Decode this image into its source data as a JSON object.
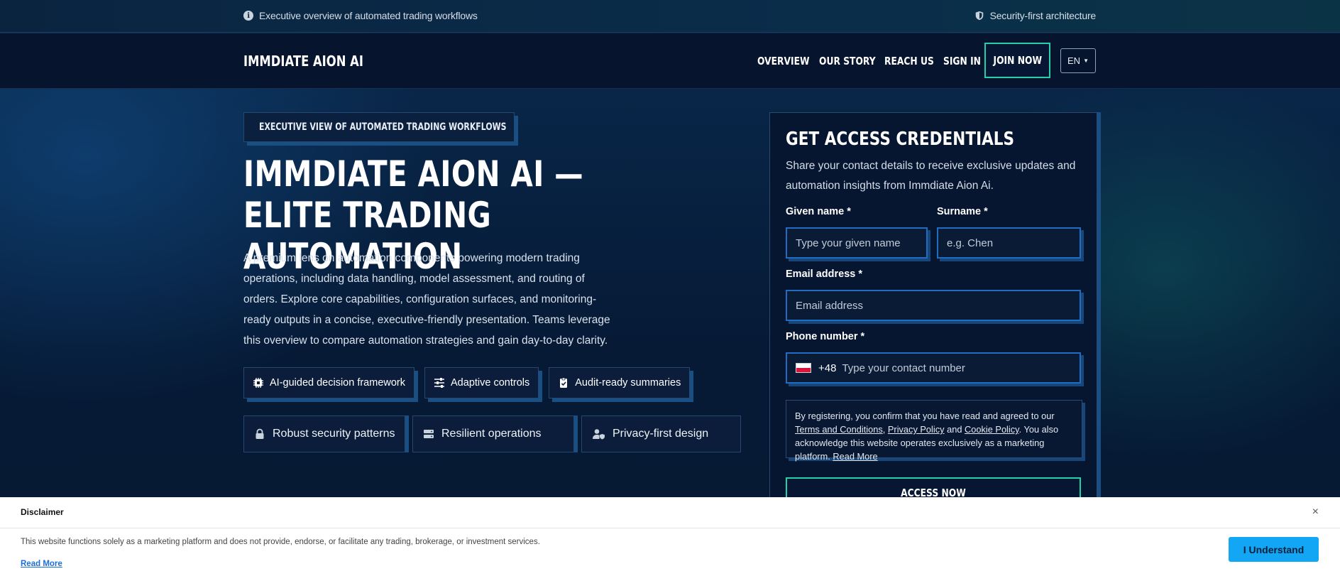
{
  "topbar": {
    "info_text": "Executive overview of automated trading workflows",
    "security_text": "Security-first architecture"
  },
  "nav": {
    "brand": "IMMDIATE AION AI",
    "links": [
      "OVERVIEW",
      "OUR STORY",
      "REACH US",
      "SIGN IN"
    ],
    "join_label": "JOIN NOW",
    "language": "EN"
  },
  "hero": {
    "eyebrow": "EXECUTIVE VIEW OF AUTOMATED TRADING WORKFLOWS",
    "title": "IMMDIATE AION AI — ELITE TRADING AUTOMATION",
    "description": "A premium lens on automation components powering modern trading operations, including data handling, model assessment, and routing of orders. Explore core capabilities, configuration surfaces, and monitoring-ready outputs in a concise, executive-friendly presentation. Teams leverage this overview to compare automation strategies and gain day-to-day clarity.",
    "chips": [
      {
        "label": "AI-guided decision framework",
        "icon": "chip-icon"
      },
      {
        "label": "Adaptive controls",
        "icon": "sliders-icon"
      },
      {
        "label": "Audit-ready summaries",
        "icon": "clipboard-check-icon"
      }
    ],
    "features": [
      {
        "label": "Robust security patterns",
        "icon": "lock-icon"
      },
      {
        "label": "Resilient operations",
        "icon": "server-icon"
      },
      {
        "label": "Privacy-first design",
        "icon": "user-shield-icon"
      }
    ]
  },
  "form": {
    "title": "GET ACCESS CREDENTIALS",
    "subtitle": "Share your contact details to receive exclusive updates and automation insights from Immdiate Aion Ai.",
    "given_name_label": "Given name *",
    "given_name_placeholder": "Type your given name",
    "surname_label": "Surname *",
    "surname_placeholder": "e.g. Chen",
    "email_label": "Email address *",
    "email_placeholder": "Email address",
    "phone_label": "Phone number *",
    "phone_prefix": "+48",
    "phone_placeholder": "Type your contact number",
    "consent_prefix": "By registering, you confirm that you have read and agreed to our ",
    "terms_link": "Terms and Conditions",
    "sep1": ", ",
    "privacy_link": "Privacy Policy",
    "sep2": " and ",
    "cookie_link": "Cookie Policy",
    "consent_suffix": ". You also acknowledge this website operates exclusively as a marketing platform. ",
    "read_more": "Read More",
    "submit_label": "ACCESS NOW"
  },
  "disclaimer": {
    "title": "Disclaimer",
    "close": "×",
    "text": "This website functions solely as a marketing platform and does not provide, endorse, or facilitate any trading, brokerage, or investment services.",
    "read_more": "Read More",
    "button": "I Understand"
  },
  "colors": {
    "accent_teal": "#24d0a8",
    "accent_blue": "#1f6cc0",
    "disclaimer_button": "#12a6f5"
  }
}
